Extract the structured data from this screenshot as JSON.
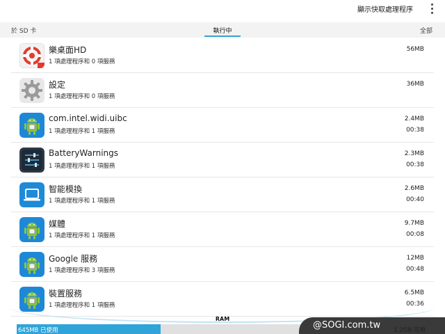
{
  "actionbar": {
    "action_label": "顯示快取處理程序",
    "menu_icon": "overflow-menu-icon"
  },
  "tabs": {
    "left": "於 SD 卡",
    "center": "執行中",
    "right": "全部"
  },
  "apps": [
    {
      "name": "樂桌面HD",
      "sub": "1 項處理程序和 0 項服務",
      "size": "56MB",
      "time": "",
      "icon": "launcher-icon"
    },
    {
      "name": "設定",
      "sub": "1 項處理程序和 0 項服務",
      "size": "36MB",
      "time": "",
      "icon": "settings-gear-icon"
    },
    {
      "name": "com.intel.widi.uibc",
      "sub": "1 項處理程序和 1 項服務",
      "size": "2.4MB",
      "time": "00:38",
      "icon": "android-robot-icon"
    },
    {
      "name": "BatteryWarnings",
      "sub": "1 項處理程序和 1 項服務",
      "size": "2.3MB",
      "time": "00:38",
      "icon": "sliders-icon"
    },
    {
      "name": "智能模換",
      "sub": "1 項處理程序和 1 項服務",
      "size": "2.6MB",
      "time": "00:40",
      "icon": "laptop-icon"
    },
    {
      "name": "媒體",
      "sub": "1 項處理程序和 1 項服務",
      "size": "9.7MB",
      "time": "00:08",
      "icon": "android-robot-icon"
    },
    {
      "name": "Google 服務",
      "sub": "1 項處理程序和 3 項服務",
      "size": "12MB",
      "time": "00:48",
      "icon": "android-robot-icon"
    },
    {
      "name": "裝置服務",
      "sub": "1 項處理程序和 1 項服務",
      "size": "6.5MB",
      "time": "00:36",
      "icon": "android-robot-icon"
    }
  ],
  "memory": {
    "label": "RAM",
    "used": "645MB 已使用",
    "free": "1.2GB 可用",
    "used_fraction": 0.35
  },
  "watermark": "@SOGI.com.tw",
  "colors": {
    "accent": "#33a3d6",
    "used_bar": "#2fa4d8",
    "android_blue": "#1e88d6",
    "android_green": "#8dc63f"
  }
}
